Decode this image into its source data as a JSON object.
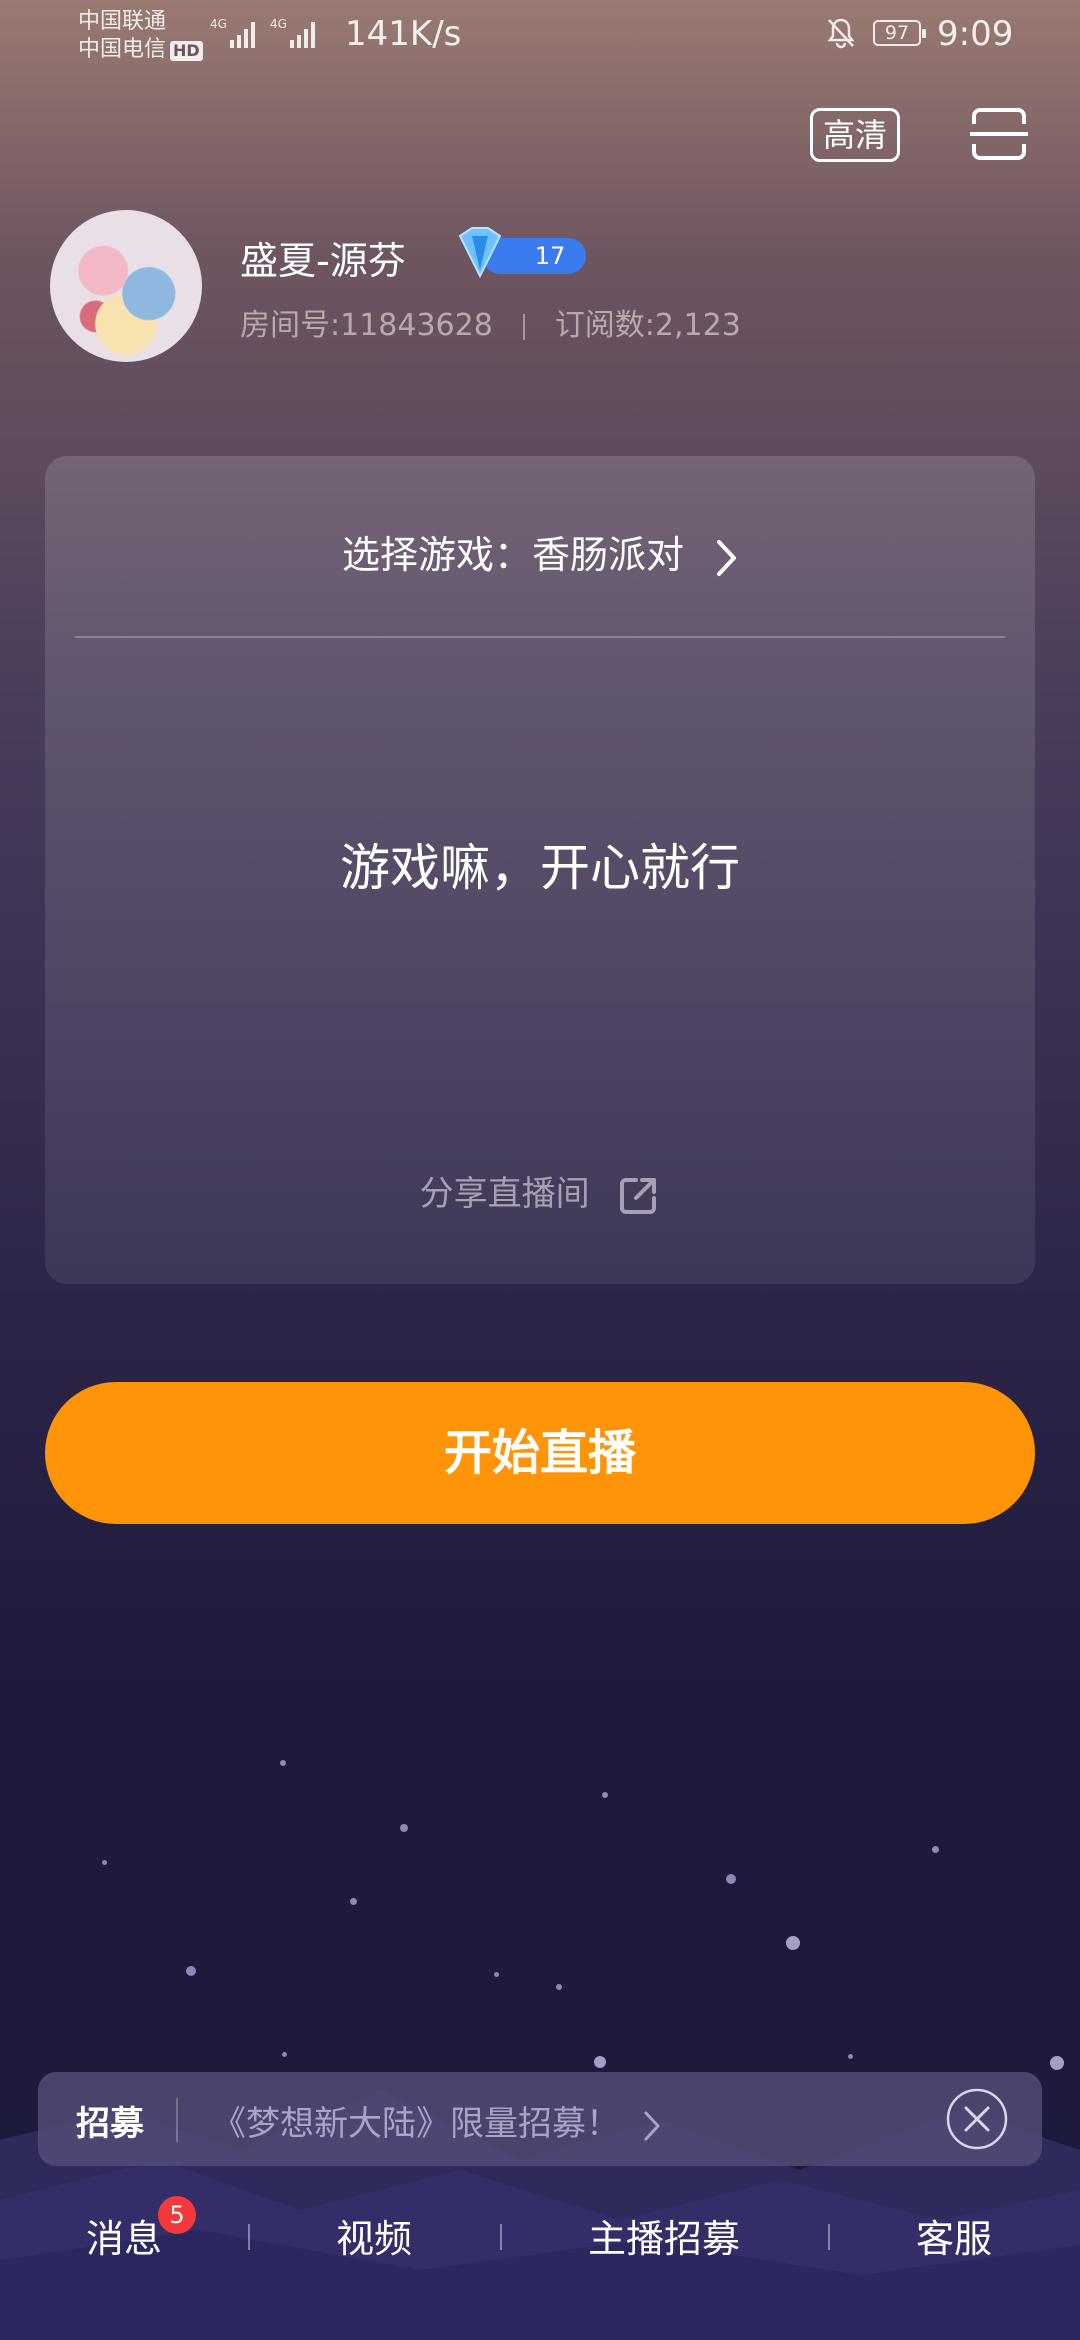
{
  "status_bar": {
    "carrier1": "中国联通",
    "carrier2": "中国电信",
    "hd": "HD",
    "net1": "4G",
    "net2": "4G",
    "speed": "141K/s",
    "battery": "97",
    "time": "9:09"
  },
  "header": {
    "quality_label": "高清"
  },
  "profile": {
    "name": "盛夏-源芬",
    "level": "17",
    "room_label": "房间号:11843628",
    "subs_label": "订阅数:2,123"
  },
  "card": {
    "game_label": "选择游戏：香肠派对",
    "slogan": "游戏嘛，开心就行",
    "share_label": "分享直播间"
  },
  "start_button": {
    "label": "开始直播"
  },
  "recruit": {
    "label": "招募",
    "text": "《梦想新大陆》限量招募！"
  },
  "bottom_nav": {
    "items": [
      {
        "label": "消息"
      },
      {
        "label": "视频"
      },
      {
        "label": "主播招募"
      },
      {
        "label": "客服"
      }
    ],
    "message_badge": "5"
  },
  "colors": {
    "accent": "#ff9408",
    "badge": "#f2393b",
    "level_badge": "#3b7bf0"
  }
}
